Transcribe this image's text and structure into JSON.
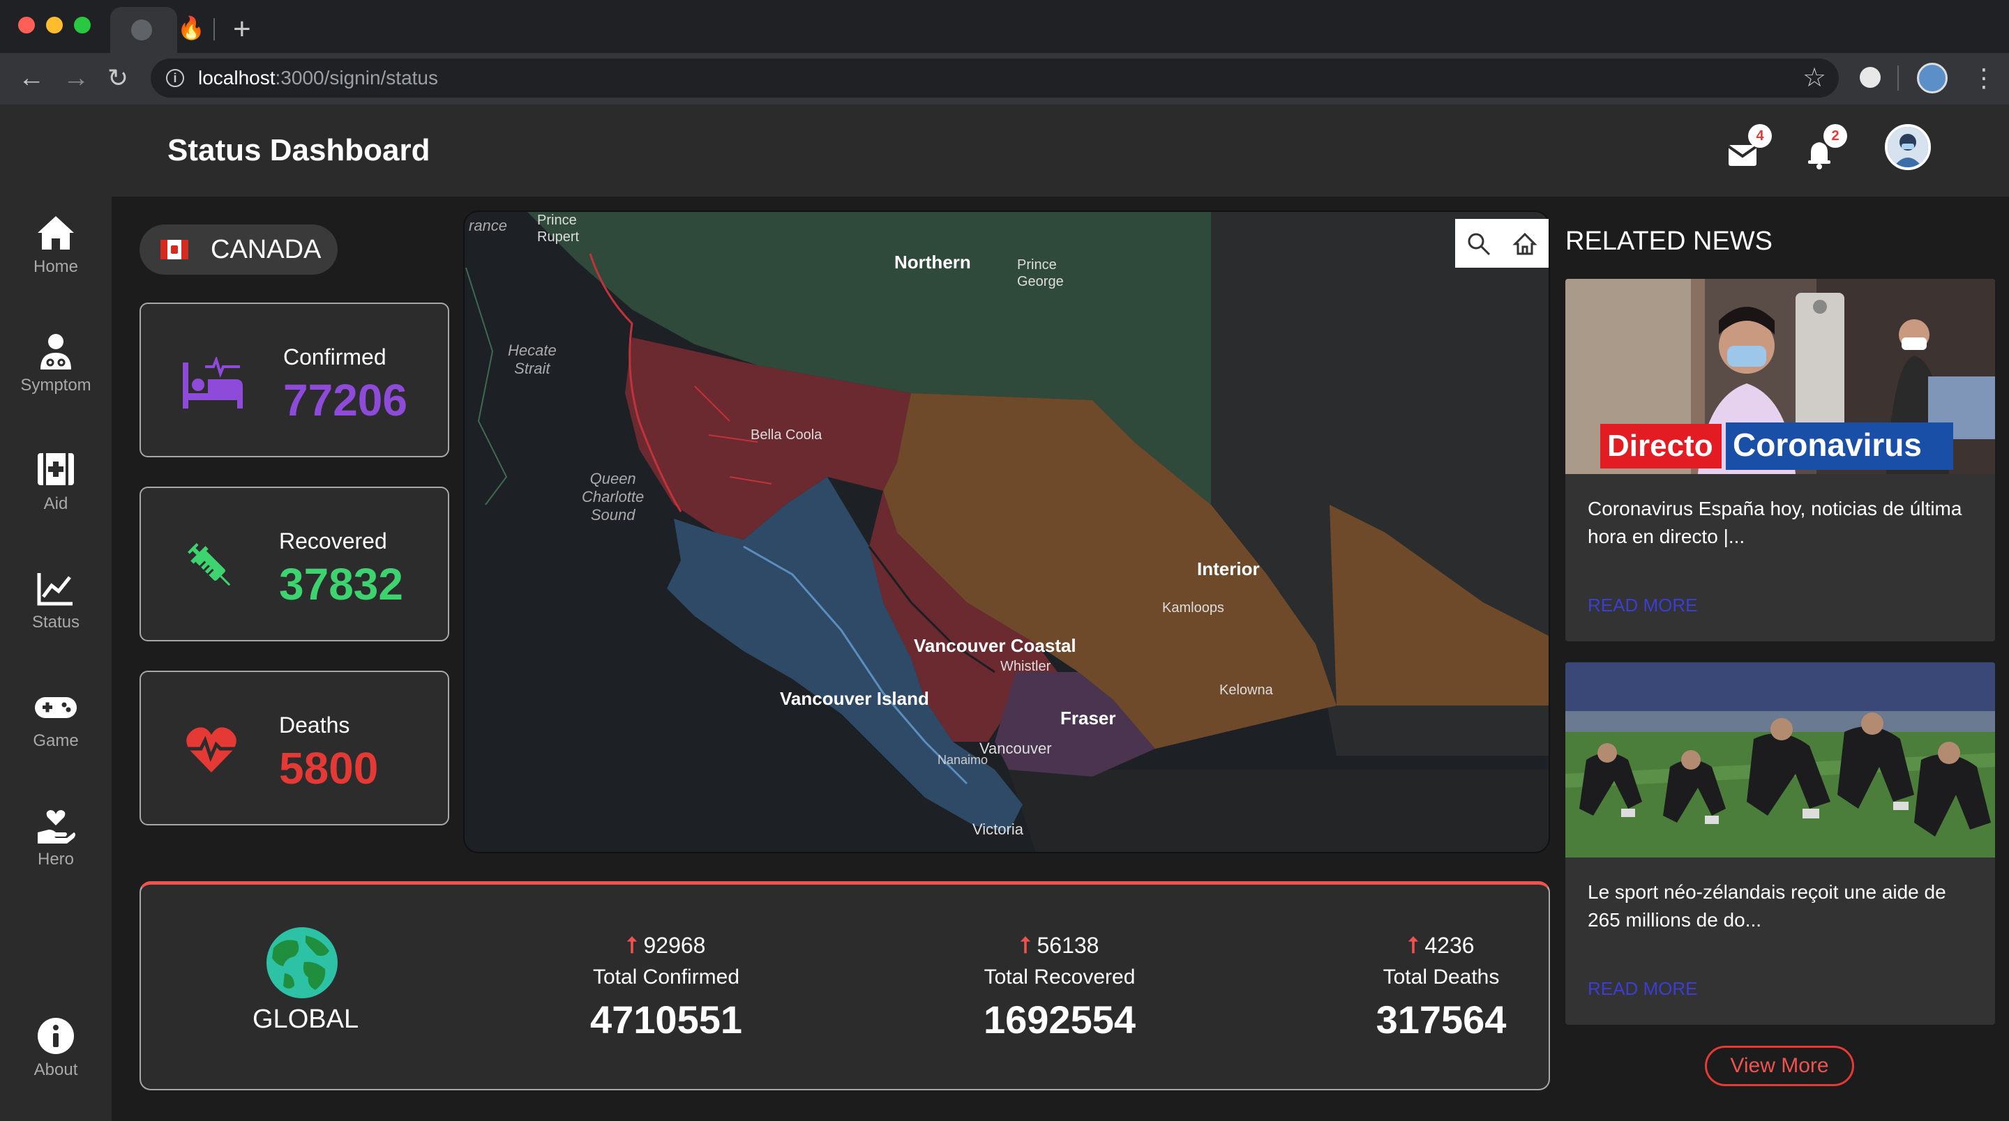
{
  "browser": {
    "url_host": "localhost",
    "url_path": ":3000/signin/status"
  },
  "app": {
    "title": "Status Dashboard",
    "mail_badge": "4",
    "notif_badge": "2"
  },
  "sidebar": {
    "items": [
      {
        "label": "Home",
        "icon": "home-icon"
      },
      {
        "label": "Symptom",
        "icon": "doctor-icon"
      },
      {
        "label": "Aid",
        "icon": "first-aid-icon"
      },
      {
        "label": "Status",
        "icon": "chart-line-icon"
      },
      {
        "label": "Game",
        "icon": "gamepad-icon"
      },
      {
        "label": "Hero",
        "icon": "hand-heart-icon"
      },
      {
        "label": "About",
        "icon": "info-icon"
      }
    ]
  },
  "country": {
    "name": "CANADA"
  },
  "stats": {
    "confirmed": {
      "label": "Confirmed",
      "value": "77206",
      "color": "#8e4ad8"
    },
    "recovered": {
      "label": "Recovered",
      "value": "37832",
      "color": "#3dd36f"
    },
    "deaths": {
      "label": "Deaths",
      "value": "5800",
      "color": "#e53935"
    }
  },
  "map": {
    "labels": {
      "rance": "rance",
      "prince_rupert": "Prince\nRupert",
      "northern": "Northern",
      "prince_george": "Prince\nGeorge",
      "hecate": "Hecate\nStrait",
      "bella_coola": "Bella Coola",
      "queen_charlotte": "Queen\nCharlotte\nSound",
      "interior": "Interior",
      "kamloops": "Kamloops",
      "vancouver_coastal": "Vancouver Coastal",
      "whistler": "Whistler",
      "kelowna": "Kelowna",
      "vancouver_island": "Vancouver Island",
      "fraser": "Fraser",
      "vancouver": "Vancouver",
      "nanaimo": "Nanaimo",
      "victoria": "Victoria"
    },
    "region_colors": {
      "northern": "#2f4a3a",
      "interior": "#6e4a2a",
      "coastal": "#6a2a30",
      "island": "#2e4a66",
      "fraser": "#4a3450"
    }
  },
  "global": {
    "label": "GLOBAL",
    "confirmed": {
      "delta": "92968",
      "label": "Total Confirmed",
      "value": "4710551"
    },
    "recovered": {
      "delta": "56138",
      "label": "Total Recovered",
      "value": "1692554"
    },
    "deaths": {
      "delta": "4236",
      "label": "Total Deaths",
      "value": "317564"
    }
  },
  "news": {
    "title": "RELATED NEWS",
    "items": [
      {
        "overlay_left": "Directo",
        "overlay_right": "Coronavirus",
        "text": "Coronavirus España hoy, noticias de última hora en directo |...",
        "read_more": "READ MORE"
      },
      {
        "text": "Le sport néo-zélandais reçoit une aide de 265 millions de do...",
        "read_more": "READ MORE"
      }
    ],
    "view_more": "View More"
  }
}
